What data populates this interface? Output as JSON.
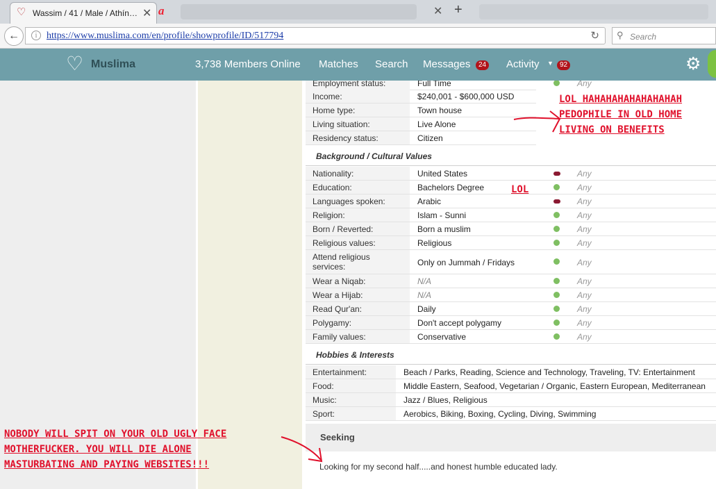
{
  "browser": {
    "tab_title": "Wassim / 41 / Male / Athín…",
    "url": "https://www.muslima.com/en/profile/showprofile/ID/517794",
    "search_placeholder": "Search"
  },
  "header": {
    "logo_text": "Muslima",
    "members_online": "3,738 Members Online",
    "nav_matches": "Matches",
    "nav_search": "Search",
    "nav_messages": "Messages",
    "messages_count": "24",
    "nav_activity": "Activity",
    "activity_count": "92"
  },
  "lifestyle": [
    {
      "label": "Employment status:",
      "value": "Full Time",
      "pref": "Any"
    },
    {
      "label": "Income:",
      "value": "$240,001 - $600,000 USD"
    },
    {
      "label": "Home type:",
      "value": "Town house"
    },
    {
      "label": "Living situation:",
      "value": "Live Alone"
    },
    {
      "label": "Residency status:",
      "value": "Citizen"
    }
  ],
  "background_title": "Background / Cultural Values",
  "background": [
    {
      "label": "Nationality:",
      "value": "United States",
      "match": false,
      "pref": "Any"
    },
    {
      "label": "Education:",
      "value": "Bachelors Degree",
      "match": true,
      "pref": "Any"
    },
    {
      "label": "Languages spoken:",
      "value": "Arabic",
      "match": false,
      "pref": "Any"
    },
    {
      "label": "Religion:",
      "value": "Islam - Sunni",
      "match": true,
      "pref": "Any"
    },
    {
      "label": "Born / Reverted:",
      "value": "Born a muslim",
      "match": true,
      "pref": "Any"
    },
    {
      "label": "Religious values:",
      "value": "Religious",
      "match": true,
      "pref": "Any"
    },
    {
      "label_line1": "Attend religious",
      "label_line2": "services:",
      "value": "Only on Jummah / Fridays",
      "match": true,
      "pref": "Any"
    },
    {
      "label": "Wear a Niqab:",
      "value": "N/A",
      "match": true,
      "pref": "Any"
    },
    {
      "label": "Wear a Hijab:",
      "value": "N/A",
      "match": true,
      "pref": "Any"
    },
    {
      "label": "Read Qur'an:",
      "value": "Daily",
      "match": true,
      "pref": "Any"
    },
    {
      "label": "Polygamy:",
      "value": "Don't accept polygamy",
      "match": true,
      "pref": "Any"
    },
    {
      "label": "Family values:",
      "value": "Conservative",
      "match": true,
      "pref": "Any"
    }
  ],
  "hobbies_title": "Hobbies & Interests",
  "hobbies": [
    {
      "label": "Entertainment:",
      "value": "Beach / Parks, Reading, Science and Technology, Traveling, TV: Entertainment"
    },
    {
      "label": "Food:",
      "value": "Middle Eastern, Seafood, Vegetarian / Organic, Eastern European, Mediterranean"
    },
    {
      "label": "Music:",
      "value": "Jazz / Blues, Religious"
    },
    {
      "label": "Sport:",
      "value": "Aerobics, Biking, Boxing, Cycling, Diving, Swimming"
    }
  ],
  "seeking": {
    "title": "Seeking",
    "text": "Looking for my second half.....and honest humble educated lady."
  },
  "annotations": {
    "top_line1": "LOL HAHAHAHAHAHAHAHAH",
    "top_line2": "PEDOPHILE IN OLD HOME",
    "top_line3": "LIVING ON BENEFITS",
    "mid": "LOL",
    "bottom_line1": "NOBODY WILL SPIT ON YOUR OLD UGLY FACE",
    "bottom_line2": "MOTHERFUCKER. YOU WILL DIE ALONE",
    "bottom_line3": "MASTURBATING AND PAYING WEBSITES!!!"
  },
  "colors": {
    "header_bg": "#6f9fa9",
    "badge": "#b1141b",
    "match_dot": "#7fbf62",
    "mismatch_dot": "#8b1a32",
    "annotation": "#e0102b"
  }
}
